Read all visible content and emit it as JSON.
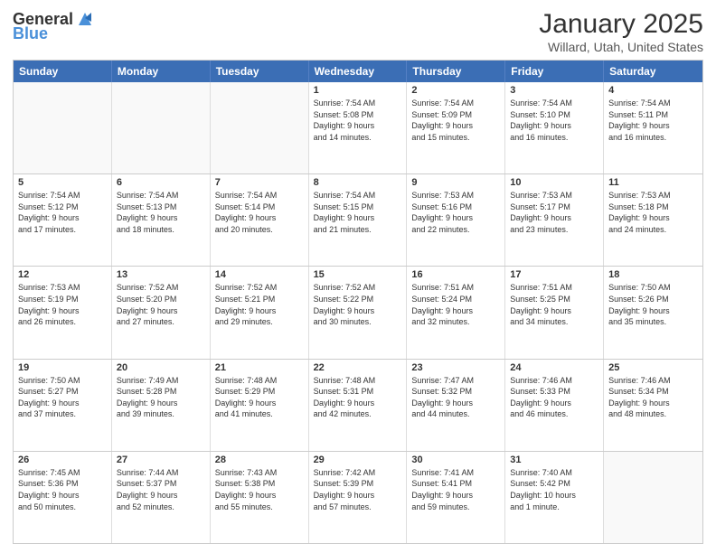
{
  "header": {
    "logo_general": "General",
    "logo_blue": "Blue",
    "month_title": "January 2025",
    "location": "Willard, Utah, United States"
  },
  "days_of_week": [
    "Sunday",
    "Monday",
    "Tuesday",
    "Wednesday",
    "Thursday",
    "Friday",
    "Saturday"
  ],
  "rows": [
    [
      {
        "day": "",
        "text": "",
        "empty": true
      },
      {
        "day": "",
        "text": "",
        "empty": true
      },
      {
        "day": "",
        "text": "",
        "empty": true
      },
      {
        "day": "1",
        "text": "Sunrise: 7:54 AM\nSunset: 5:08 PM\nDaylight: 9 hours\nand 14 minutes."
      },
      {
        "day": "2",
        "text": "Sunrise: 7:54 AM\nSunset: 5:09 PM\nDaylight: 9 hours\nand 15 minutes."
      },
      {
        "day": "3",
        "text": "Sunrise: 7:54 AM\nSunset: 5:10 PM\nDaylight: 9 hours\nand 16 minutes."
      },
      {
        "day": "4",
        "text": "Sunrise: 7:54 AM\nSunset: 5:11 PM\nDaylight: 9 hours\nand 16 minutes."
      }
    ],
    [
      {
        "day": "5",
        "text": "Sunrise: 7:54 AM\nSunset: 5:12 PM\nDaylight: 9 hours\nand 17 minutes."
      },
      {
        "day": "6",
        "text": "Sunrise: 7:54 AM\nSunset: 5:13 PM\nDaylight: 9 hours\nand 18 minutes."
      },
      {
        "day": "7",
        "text": "Sunrise: 7:54 AM\nSunset: 5:14 PM\nDaylight: 9 hours\nand 20 minutes."
      },
      {
        "day": "8",
        "text": "Sunrise: 7:54 AM\nSunset: 5:15 PM\nDaylight: 9 hours\nand 21 minutes."
      },
      {
        "day": "9",
        "text": "Sunrise: 7:53 AM\nSunset: 5:16 PM\nDaylight: 9 hours\nand 22 minutes."
      },
      {
        "day": "10",
        "text": "Sunrise: 7:53 AM\nSunset: 5:17 PM\nDaylight: 9 hours\nand 23 minutes."
      },
      {
        "day": "11",
        "text": "Sunrise: 7:53 AM\nSunset: 5:18 PM\nDaylight: 9 hours\nand 24 minutes."
      }
    ],
    [
      {
        "day": "12",
        "text": "Sunrise: 7:53 AM\nSunset: 5:19 PM\nDaylight: 9 hours\nand 26 minutes."
      },
      {
        "day": "13",
        "text": "Sunrise: 7:52 AM\nSunset: 5:20 PM\nDaylight: 9 hours\nand 27 minutes."
      },
      {
        "day": "14",
        "text": "Sunrise: 7:52 AM\nSunset: 5:21 PM\nDaylight: 9 hours\nand 29 minutes."
      },
      {
        "day": "15",
        "text": "Sunrise: 7:52 AM\nSunset: 5:22 PM\nDaylight: 9 hours\nand 30 minutes."
      },
      {
        "day": "16",
        "text": "Sunrise: 7:51 AM\nSunset: 5:24 PM\nDaylight: 9 hours\nand 32 minutes."
      },
      {
        "day": "17",
        "text": "Sunrise: 7:51 AM\nSunset: 5:25 PM\nDaylight: 9 hours\nand 34 minutes."
      },
      {
        "day": "18",
        "text": "Sunrise: 7:50 AM\nSunset: 5:26 PM\nDaylight: 9 hours\nand 35 minutes."
      }
    ],
    [
      {
        "day": "19",
        "text": "Sunrise: 7:50 AM\nSunset: 5:27 PM\nDaylight: 9 hours\nand 37 minutes."
      },
      {
        "day": "20",
        "text": "Sunrise: 7:49 AM\nSunset: 5:28 PM\nDaylight: 9 hours\nand 39 minutes."
      },
      {
        "day": "21",
        "text": "Sunrise: 7:48 AM\nSunset: 5:29 PM\nDaylight: 9 hours\nand 41 minutes."
      },
      {
        "day": "22",
        "text": "Sunrise: 7:48 AM\nSunset: 5:31 PM\nDaylight: 9 hours\nand 42 minutes."
      },
      {
        "day": "23",
        "text": "Sunrise: 7:47 AM\nSunset: 5:32 PM\nDaylight: 9 hours\nand 44 minutes."
      },
      {
        "day": "24",
        "text": "Sunrise: 7:46 AM\nSunset: 5:33 PM\nDaylight: 9 hours\nand 46 minutes."
      },
      {
        "day": "25",
        "text": "Sunrise: 7:46 AM\nSunset: 5:34 PM\nDaylight: 9 hours\nand 48 minutes."
      }
    ],
    [
      {
        "day": "26",
        "text": "Sunrise: 7:45 AM\nSunset: 5:36 PM\nDaylight: 9 hours\nand 50 minutes."
      },
      {
        "day": "27",
        "text": "Sunrise: 7:44 AM\nSunset: 5:37 PM\nDaylight: 9 hours\nand 52 minutes."
      },
      {
        "day": "28",
        "text": "Sunrise: 7:43 AM\nSunset: 5:38 PM\nDaylight: 9 hours\nand 55 minutes."
      },
      {
        "day": "29",
        "text": "Sunrise: 7:42 AM\nSunset: 5:39 PM\nDaylight: 9 hours\nand 57 minutes."
      },
      {
        "day": "30",
        "text": "Sunrise: 7:41 AM\nSunset: 5:41 PM\nDaylight: 9 hours\nand 59 minutes."
      },
      {
        "day": "31",
        "text": "Sunrise: 7:40 AM\nSunset: 5:42 PM\nDaylight: 10 hours\nand 1 minute."
      },
      {
        "day": "",
        "text": "",
        "empty": true
      }
    ]
  ]
}
